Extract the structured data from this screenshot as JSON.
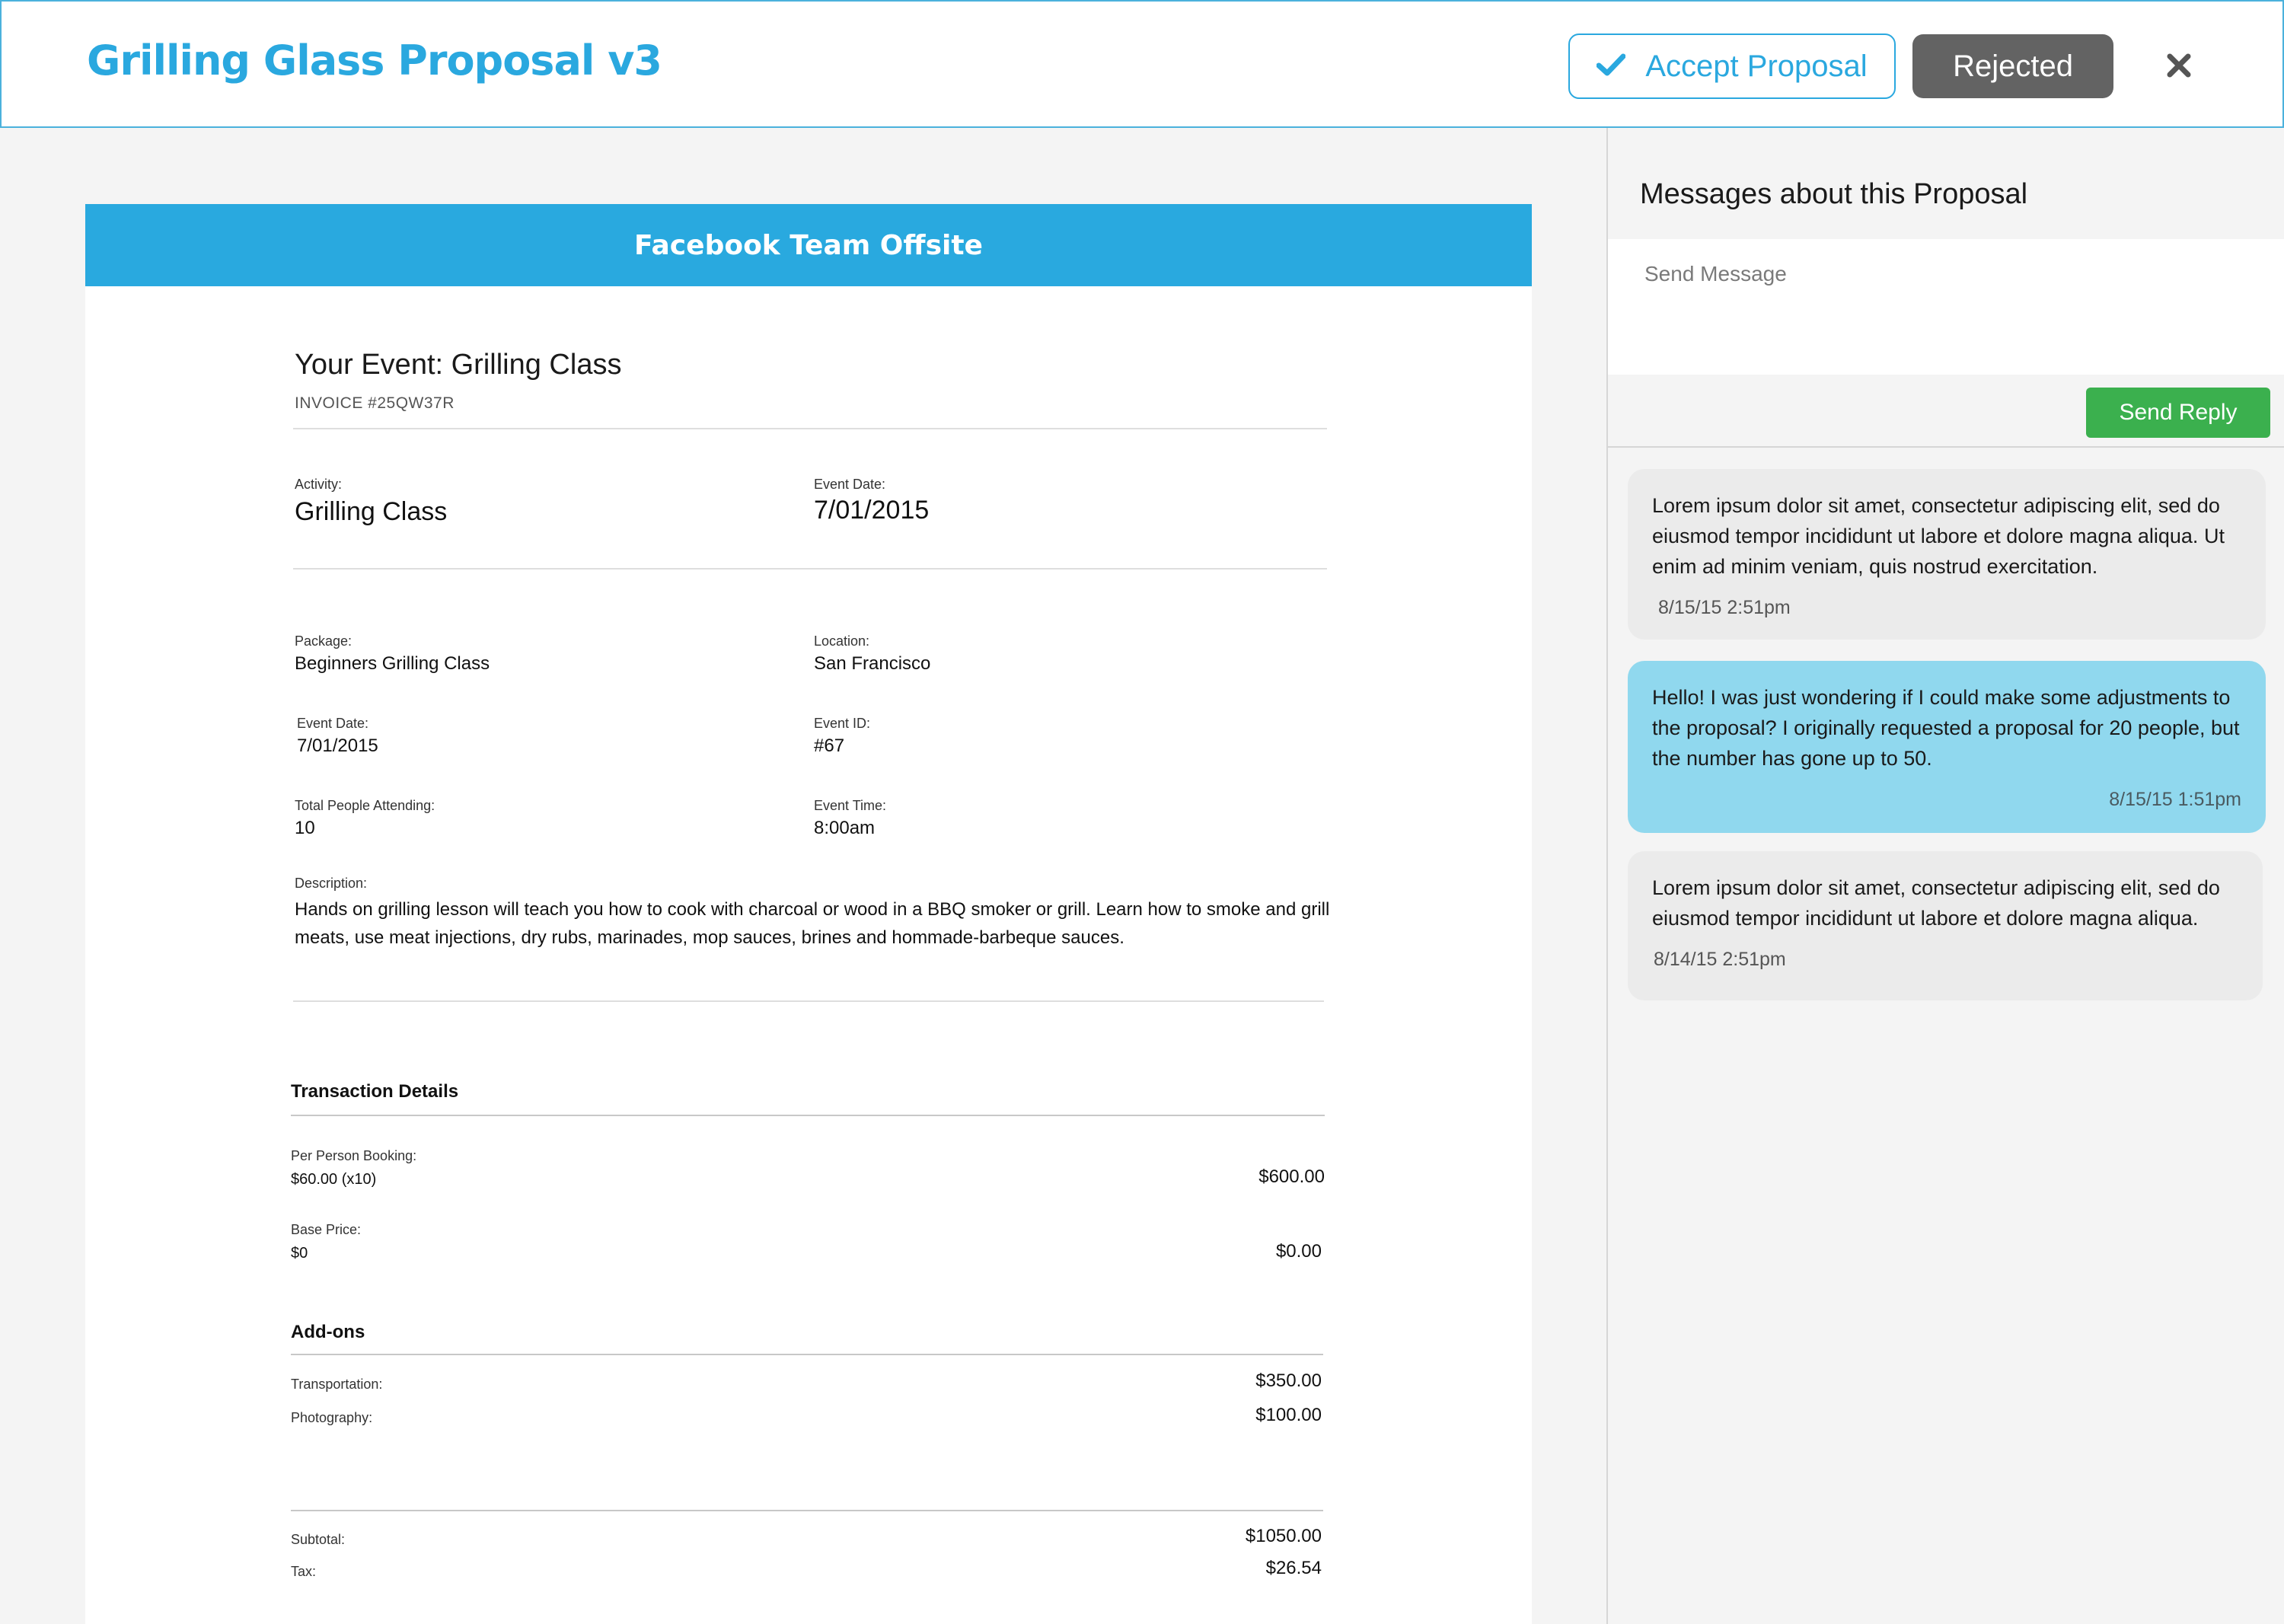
{
  "header": {
    "title": "Grilling Glass Proposal v3",
    "accept_label": "Accept Proposal",
    "rejected_label": "Rejected"
  },
  "document": {
    "banner": "Facebook Team Offsite",
    "event_heading": "Your Event: Grilling Class",
    "invoice": "INVOICE #25QW37R",
    "activity": {
      "label": "Activity:",
      "value": "Grilling Class"
    },
    "event_date_top": {
      "label": "Event Date:",
      "value": "7/01/2015"
    },
    "package": {
      "label": "Package:",
      "value": "Beginners Grilling Class"
    },
    "location": {
      "label": "Location:",
      "value": "San Francisco"
    },
    "event_date": {
      "label": "Event Date:",
      "value": "7/01/2015"
    },
    "event_id": {
      "label": "Event ID:",
      "value": "#67"
    },
    "total_people": {
      "label": "Total People Attending:",
      "value": "10"
    },
    "event_time": {
      "label": "Event Time:",
      "value": "8:00am"
    },
    "description": {
      "label": "Description:",
      "value": "Hands on grilling lesson will teach you how to cook with charcoal or wood in a BBQ smoker or grill. Learn how to smoke and grill meats, use meat injections, dry rubs, marinades, mop sauces, brines and hommade-barbeque sauces."
    },
    "transaction": {
      "heading": "Transaction Details",
      "per_person": {
        "label": "Per Person Booking:",
        "detail": "$60.00 (x10)",
        "amount": "$600.00"
      },
      "base_price": {
        "label": "Base Price:",
        "detail": "$0",
        "amount": "$0.00"
      }
    },
    "addons": {
      "heading": "Add-ons",
      "transportation": {
        "label": "Transportation:",
        "amount": "$350.00"
      },
      "photography": {
        "label": "Photography:",
        "amount": "$100.00"
      }
    },
    "totals": {
      "subtotal": {
        "label": "Subtotal:",
        "amount": "$1050.00"
      },
      "tax": {
        "label": "Tax:",
        "amount": "$26.54"
      }
    }
  },
  "messages": {
    "title": "Messages about this Proposal",
    "input_placeholder": "Send Message",
    "send_label": "Send Reply",
    "items": [
      {
        "text": "Lorem ipsum dolor sit amet, consectetur adipiscing elit, sed do eiusmod tempor incididunt ut labore et dolore magna aliqua. Ut enim ad minim veniam, quis nostrud exercitation.",
        "time": "8/15/15 2:51pm"
      },
      {
        "text": "Hello! I was just wondering if I could make some adjustments to the proposal? I originally requested a proposal for 20 people, but the number has gone up to 50.",
        "time": "8/15/15 1:51pm"
      },
      {
        "text": "Lorem ipsum dolor sit amet, consectetur adipiscing elit, sed do eiusmod tempor incididunt ut labore et dolore magna aliqua.",
        "time": "8/14/15 2:51pm"
      }
    ]
  },
  "colors": {
    "accent": "#29a9df",
    "rejected": "#636363",
    "send": "#3bb04e",
    "own_message": "#90d8ee",
    "other_message": "#ebebeb"
  },
  "icons": {
    "accept": "check-icon",
    "close": "close-icon"
  }
}
